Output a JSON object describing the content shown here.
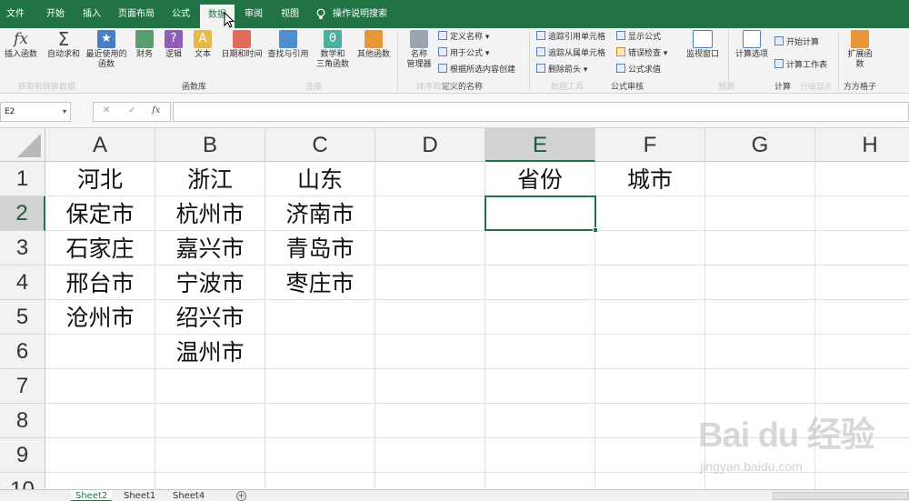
{
  "menu": {
    "tabs": [
      "文件",
      "开始",
      "插入",
      "页面布局",
      "公式",
      "数据",
      "审阅",
      "视图"
    ],
    "active_tab": "数据",
    "tell_me": "操作说明搜索"
  },
  "ribbon": {
    "buttons": {
      "insert_function": "插入函数",
      "autosum": "自动求和",
      "recent_1": "最近使用的",
      "recent_2": "函数",
      "financial": "财务",
      "logical": "逻辑",
      "text": "文本",
      "datetime": "日期和时间",
      "lookup": "查找与引用",
      "math_1": "数学和",
      "math_2": "三角函数",
      "more": "其他函数",
      "name_mgr_1": "名称",
      "name_mgr_2": "管理器",
      "watch_window": "监视窗口",
      "calc_options": "计算选项",
      "expand_1": "扩展函",
      "expand_2": "数"
    },
    "small": {
      "define_name": "定义名称",
      "use_in_formula": "用于公式",
      "create_from_sel": "根据所选内容创建",
      "trace_precedents": "追踪引用单元格",
      "trace_dependents": "追踪从属单元格",
      "remove_arrows": "删除箭头",
      "show_formulas": "显示公式",
      "error_checking": "错误检查",
      "evaluate_formula": "公式求值",
      "calc_now": "开始计算",
      "calc_sheet": "计算工作表"
    },
    "groups": {
      "function_library": "函数库",
      "defined_names": "定义的名称",
      "formula_auditing": "公式审核",
      "calculation": "计算",
      "fangfang": "方方格子",
      "faded_1": "获取和转换数据",
      "faded_2": "连接",
      "faded_3": "排序和筛选",
      "faded_4": "数据工具",
      "faded_5": "预测",
      "faded_6": "分级显示"
    }
  },
  "formula_bar": {
    "name_box": "E2",
    "cancel": "✕",
    "enter": "✓",
    "fx": "fx",
    "content": ""
  },
  "grid": {
    "columns": [
      "A",
      "B",
      "C",
      "D",
      "E",
      "F",
      "G",
      "H"
    ],
    "rows": [
      "1",
      "2",
      "3",
      "4",
      "5",
      "6",
      "7",
      "8",
      "9",
      "10"
    ],
    "selected_cell": "E2",
    "cells": {
      "A1": "河北",
      "B1": "浙江",
      "C1": "山东",
      "E1": "省份",
      "F1": "城市",
      "A2": "保定市",
      "B2": "杭州市",
      "C2": "济南市",
      "A3": "石家庄",
      "B3": "嘉兴市",
      "C3": "青岛市",
      "A4": "邢台市",
      "B4": "宁波市",
      "C4": "枣庄市",
      "A5": "沧州市",
      "B5": "绍兴市",
      "B6": "温州市"
    }
  },
  "sheets": {
    "tabs": [
      "Sheet2",
      "Sheet1",
      "Sheet4"
    ],
    "active": "Sheet2",
    "add": "+"
  },
  "watermark": {
    "logo": "Bai du 经验",
    "url": "jingyan.baidu.com"
  },
  "colors": {
    "brand_green": "#217346",
    "ribbon_bg": "#f3f3f3",
    "header_bg": "#f2f2f2"
  }
}
